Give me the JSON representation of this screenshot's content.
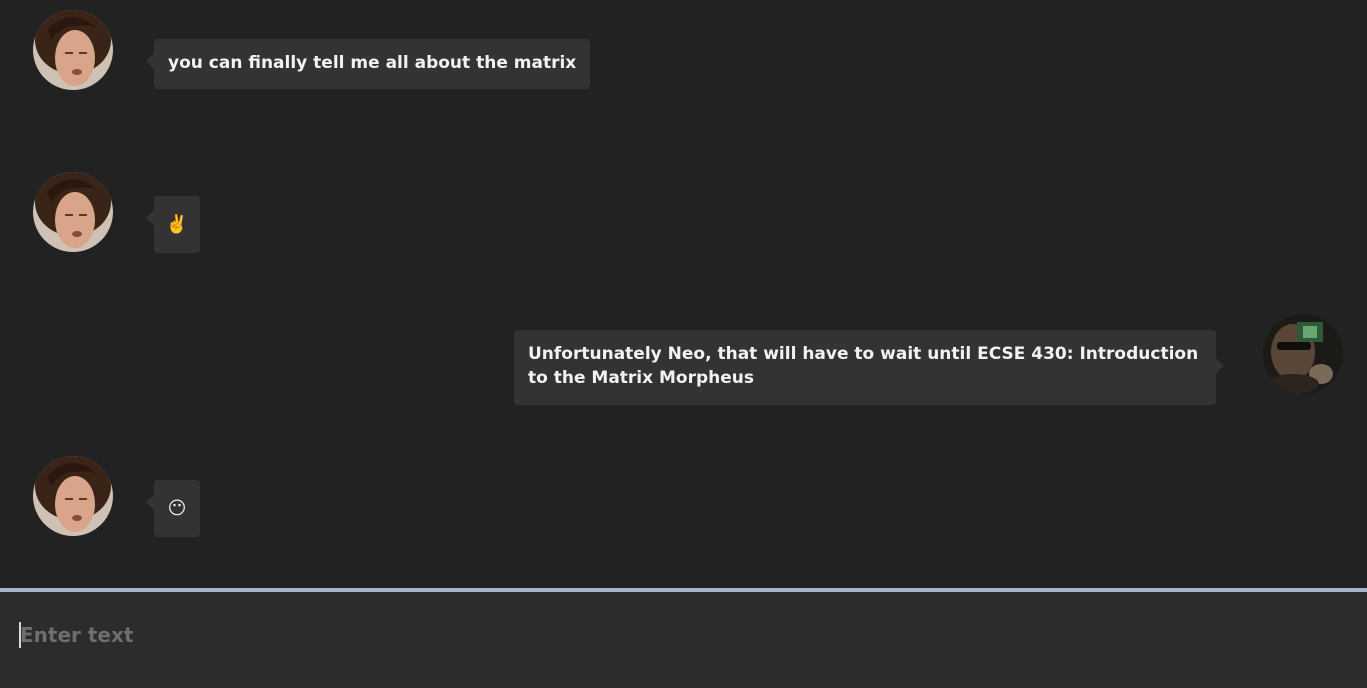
{
  "messages": [
    {
      "sender": "neo",
      "text": "you can finally tell me all about the matrix"
    },
    {
      "sender": "neo",
      "text": "✌️"
    },
    {
      "sender": "morpheus",
      "text": "Unfortunately Neo, that will have to wait until ECSE 430: Introduction to the Matrix Morpheus"
    },
    {
      "sender": "neo",
      "text": "😶"
    }
  ],
  "avatars": {
    "neo": "neo-avatar",
    "morpheus": "morpheus-avatar"
  },
  "composer": {
    "placeholder": "Enter text",
    "value": ""
  },
  "colors": {
    "background": "#222223",
    "bubble": "#333334",
    "divider": "#a9b3cf",
    "input_bar": "#2c2c2d"
  }
}
